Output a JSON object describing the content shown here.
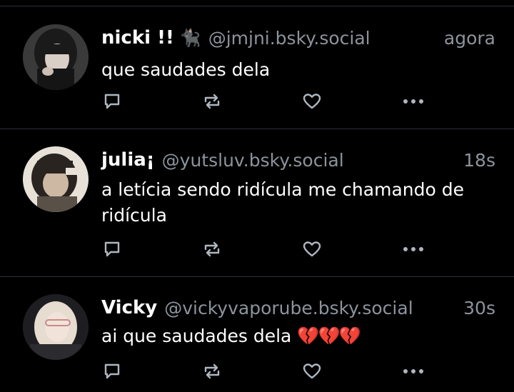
{
  "posts": [
    {
      "name": "nicki !!",
      "emoji": "🐈‍⬛",
      "handle": "@jmjni.bsky.social",
      "time": "agora",
      "text": "que saudades dela"
    },
    {
      "name": "julia¡",
      "handle": "@yutsluv.bsky.social",
      "time": "18s",
      "text": "a letícia sendo ridícula me chamando de ridícula"
    },
    {
      "name": "Vicky",
      "handle": "@vickyvaporube.bsky.social",
      "time": "30s",
      "text": "ai que saudades dela",
      "hearts": "💔💔💔"
    }
  ],
  "icons": {
    "reply": "reply-icon",
    "repost": "repost-icon",
    "like": "heart-icon",
    "more": "more-options-icon"
  },
  "colors": {
    "background": "#000000",
    "secondary_text": "#8c939c",
    "divider": "#2a2f36",
    "icon": "#aeb6c0"
  }
}
